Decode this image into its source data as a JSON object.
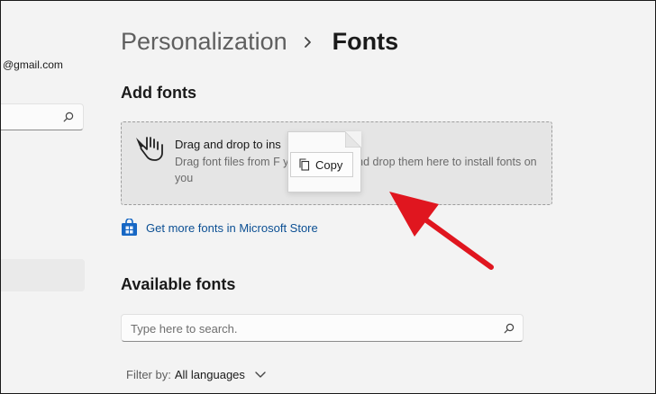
{
  "nav": {
    "account_email": "@gmail.com",
    "search_placeholder": ""
  },
  "header": {
    "parent": "Personalization",
    "current": "Fonts"
  },
  "add_fonts": {
    "title": "Add fonts",
    "dropzone_title": "Drag and drop to ins",
    "dropzone_desc": "Drag font files from F                          your desktop and drop them here to install fonts on you",
    "copy_label": "Copy"
  },
  "store_link": {
    "label": "Get more fonts in Microsoft Store"
  },
  "available_fonts": {
    "title": "Available fonts",
    "search_placeholder": "Type here to search.",
    "filter_label": "Filter by:",
    "filter_value": "All languages"
  },
  "colors": {
    "link": "#0b4f93",
    "annotation_arrow": "#e0161f"
  },
  "icons": [
    "search-icon",
    "chevron-right-icon",
    "drag-hand-icon",
    "copy-icon",
    "store-icon",
    "chevron-down-icon",
    "annotation-arrow"
  ]
}
